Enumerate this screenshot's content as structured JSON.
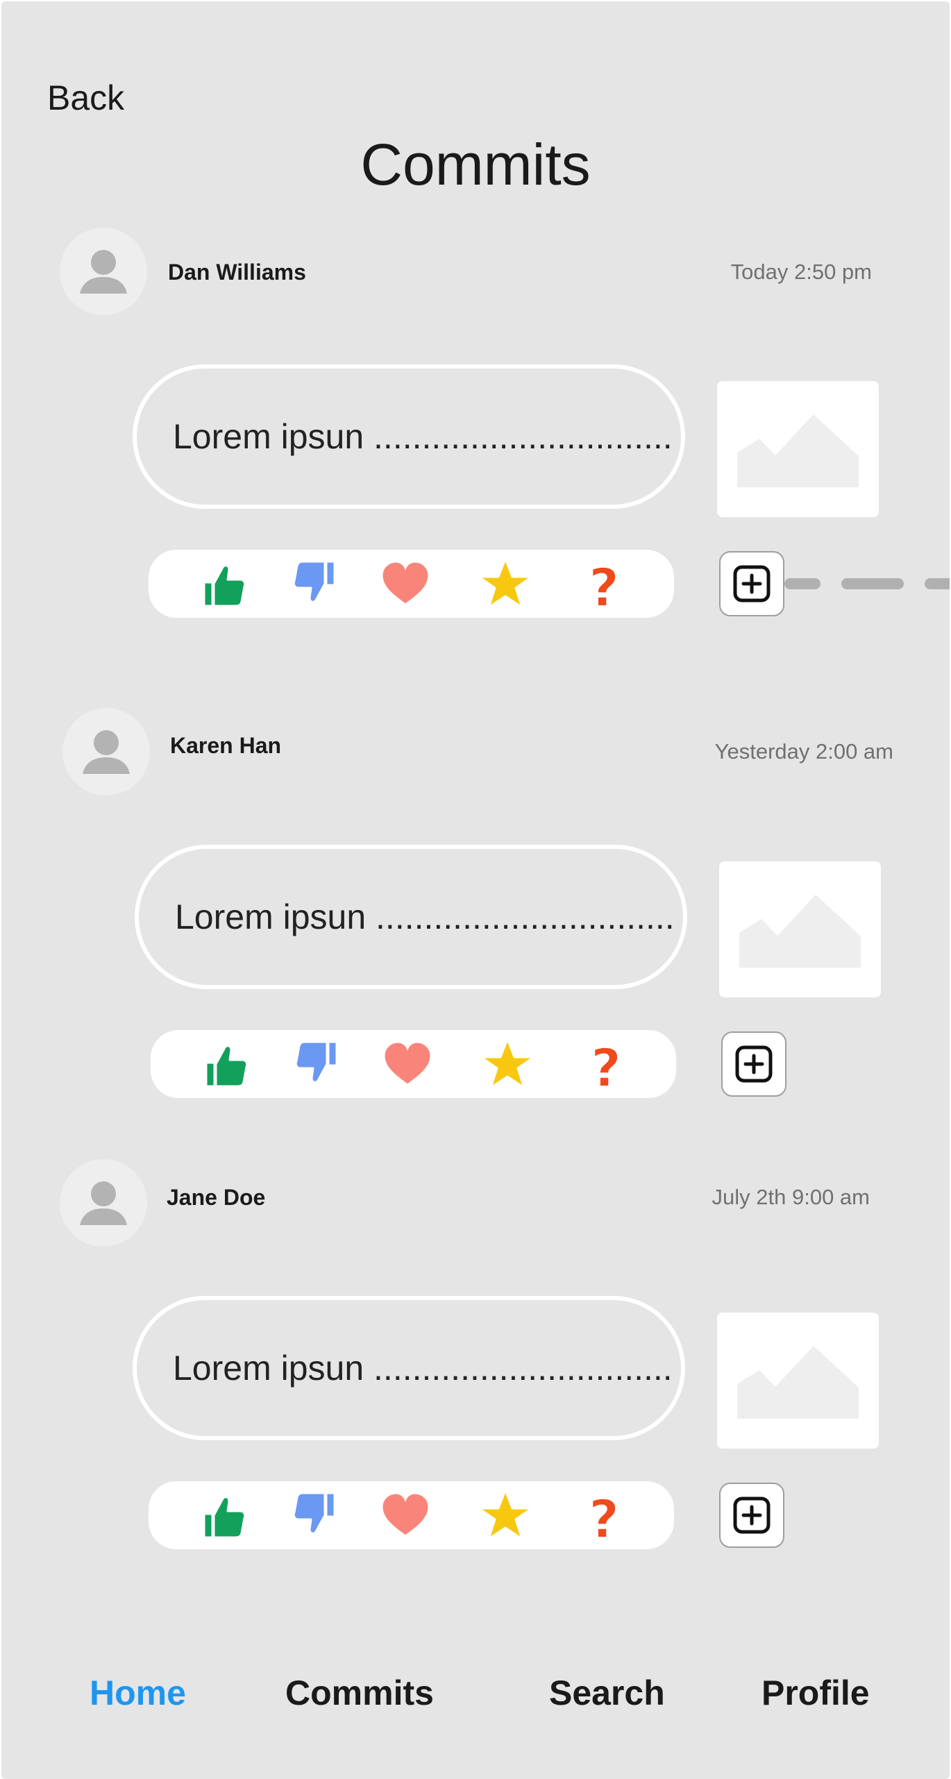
{
  "header": {
    "back_label": "Back",
    "title": "Commits"
  },
  "posts": [
    {
      "author": "Dan Williams",
      "time": "Today 2:50 pm",
      "text": "Lorem ipsun ..............................."
    },
    {
      "author": "Karen Han",
      "time": "Yesterday 2:00 am",
      "text": "Lorem ipsun ..............................."
    },
    {
      "author": "Jane Doe",
      "time": "July 2th 9:00 am",
      "text": "Lorem ipsun ..............................."
    }
  ],
  "icons": {
    "avatar": "user-avatar-icon",
    "image": "image-placeholder-icon",
    "reactions": [
      "thumbs-up-icon",
      "thumbs-down-icon",
      "heart-icon",
      "star-icon",
      "question-mark-icon"
    ],
    "add": "plus-square-icon"
  },
  "colors": {
    "background": "#e5e5e5",
    "nav_active": "#1e96f0",
    "thumbs_up": "#12a05a",
    "thumbs_down": "#6b98f2",
    "heart": "#f9857a",
    "star": "#f7c80f",
    "question": "#ef4a1c"
  },
  "nav": {
    "items": [
      {
        "label": "Home",
        "active": true
      },
      {
        "label": "Commits",
        "active": false
      },
      {
        "label": "Search",
        "active": false
      },
      {
        "label": "Profile",
        "active": false
      }
    ]
  }
}
